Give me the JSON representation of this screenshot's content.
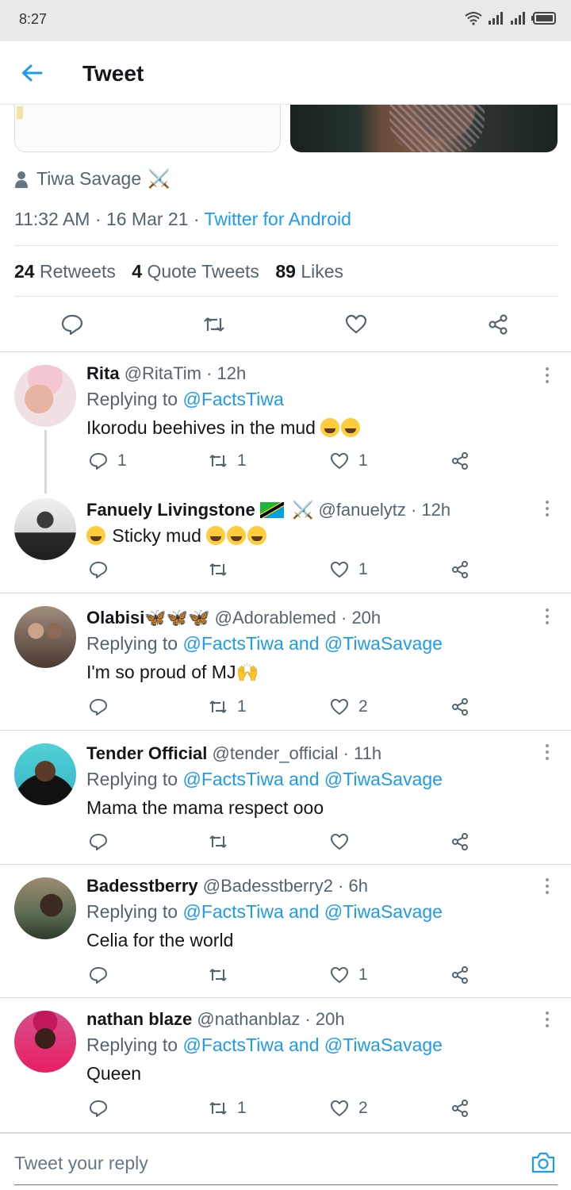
{
  "status": {
    "time": "8:27"
  },
  "header": {
    "title": "Tweet"
  },
  "tweet": {
    "author": "Tiwa Savage",
    "author_emoji": "⚔️",
    "time": "11:32 AM",
    "sep1": "·",
    "date": "16 Mar 21",
    "sep2": "·",
    "client": "Twitter for Android",
    "stats": {
      "retweets_count": "24",
      "retweets_label": "Retweets",
      "quotes_count": "4",
      "quotes_label": "Quote Tweets",
      "likes_count": "89",
      "likes_label": "Likes"
    }
  },
  "replies": [
    {
      "name": "Rita",
      "handle": "@RitaTim",
      "time": "· 12h",
      "replying_prefix": "Replying to",
      "replying_to": "@FactsTiwa",
      "text": "Ikorodu beehives in the mud",
      "replies": "1",
      "retweets": "1",
      "likes": "1"
    },
    {
      "name": "Fanuely Livingstone",
      "emoji": "⚔️",
      "handle": "@fanuelytz",
      "time": "· 12h",
      "text": "Sticky mud",
      "replies": "",
      "retweets": "",
      "likes": "1"
    },
    {
      "name": "Olabisi🦋🦋🦋",
      "handle": "@Adorablemed",
      "time": "· 20h",
      "replying_prefix": "Replying to",
      "replying_to": "@FactsTiwa and @TiwaSavage",
      "text": "I'm so proud of MJ🙌",
      "replies": "",
      "retweets": "1",
      "likes": "2"
    },
    {
      "name": "Tender Official",
      "handle": "@tender_official",
      "time": "· 11h",
      "replying_prefix": "Replying to",
      "replying_to": "@FactsTiwa and @TiwaSavage",
      "text": "Mama the mama respect ooo",
      "replies": "",
      "retweets": "",
      "likes": ""
    },
    {
      "name": "Badesstberry",
      "handle": "@Badesstberry2",
      "time": "· 6h",
      "replying_prefix": "Replying to",
      "replying_to": "@FactsTiwa and @TiwaSavage",
      "text": "Celia for the world",
      "replies": "",
      "retweets": "",
      "likes": "1"
    },
    {
      "name": "nathan blaze",
      "handle": "@nathanblaz",
      "time": "· 20h",
      "replying_prefix": "Replying to",
      "replying_to": "@FactsTiwa and @TiwaSavage",
      "text": "Queen",
      "replies": "",
      "retweets": "1",
      "likes": "2"
    }
  ],
  "composer": {
    "placeholder": "Tweet your reply"
  },
  "colors": {
    "accent": "#1d9bf0",
    "secondary_text": "#536471"
  }
}
